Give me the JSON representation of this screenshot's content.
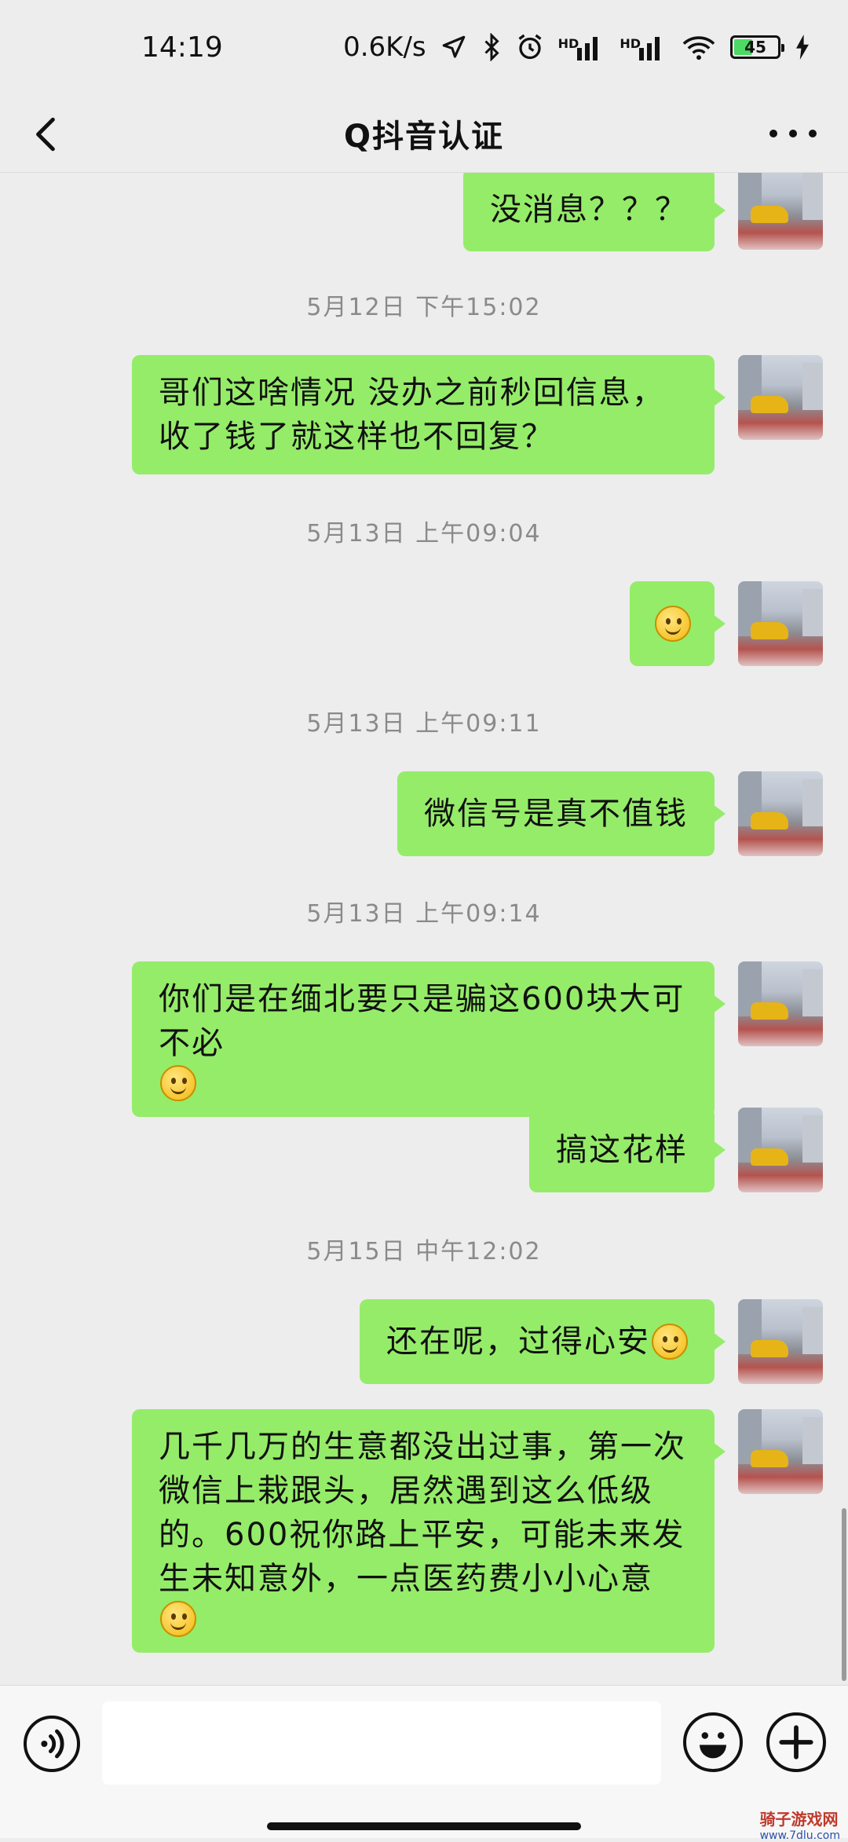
{
  "status_bar": {
    "time": "14:19",
    "network_speed": "0.6K/s",
    "signal_label_1": "HD",
    "signal_label_2": "HD",
    "battery_level": "45",
    "icons": [
      "location-icon",
      "bluetooth-icon",
      "alarm-icon",
      "signal-icon",
      "signal-icon",
      "wifi-icon",
      "battery-icon",
      "charging-icon"
    ]
  },
  "nav": {
    "title": "Q抖音认证",
    "back_icon": "chevron-left-icon",
    "more_icon": "more-dots-icon"
  },
  "messages": [
    {
      "type": "sent",
      "text": "没消息？？？",
      "emoji": false
    },
    {
      "type": "time",
      "text": "5月12日 下午15:02"
    },
    {
      "type": "sent",
      "text": "哥们这啥情况 没办之前秒回信息，收了钱了就这样也不回复？",
      "emoji": false
    },
    {
      "type": "time",
      "text": "5月13日 上午09:04"
    },
    {
      "type": "sent",
      "text": "",
      "emoji": true
    },
    {
      "type": "time",
      "text": "5月13日 上午09:11"
    },
    {
      "type": "sent",
      "text": "微信号是真不值钱",
      "emoji": false
    },
    {
      "type": "time",
      "text": "5月13日 上午09:14"
    },
    {
      "type": "sent",
      "text": "你们是在缅北要只是骗这600块大可不必",
      "emoji": true
    },
    {
      "type": "sent",
      "text": "搞这花样",
      "emoji": false
    },
    {
      "type": "time",
      "text": "5月15日 中午12:02"
    },
    {
      "type": "sent",
      "text": "还在呢，过得心安",
      "emoji": true
    },
    {
      "type": "sent",
      "text": "几千几万的生意都没出过事，第一次微信上栽跟头，居然遇到这么低级的。600祝你路上平安，可能未来发生未知意外，一点医药费小小心意",
      "emoji": true
    }
  ],
  "input_bar": {
    "voice_icon": "voice-icon",
    "input_value": "",
    "emoji_icon": "emoji-icon",
    "plus_icon": "plus-icon"
  },
  "watermark": {
    "text": "骑子游戏网",
    "url": "www.7dlu.com"
  }
}
